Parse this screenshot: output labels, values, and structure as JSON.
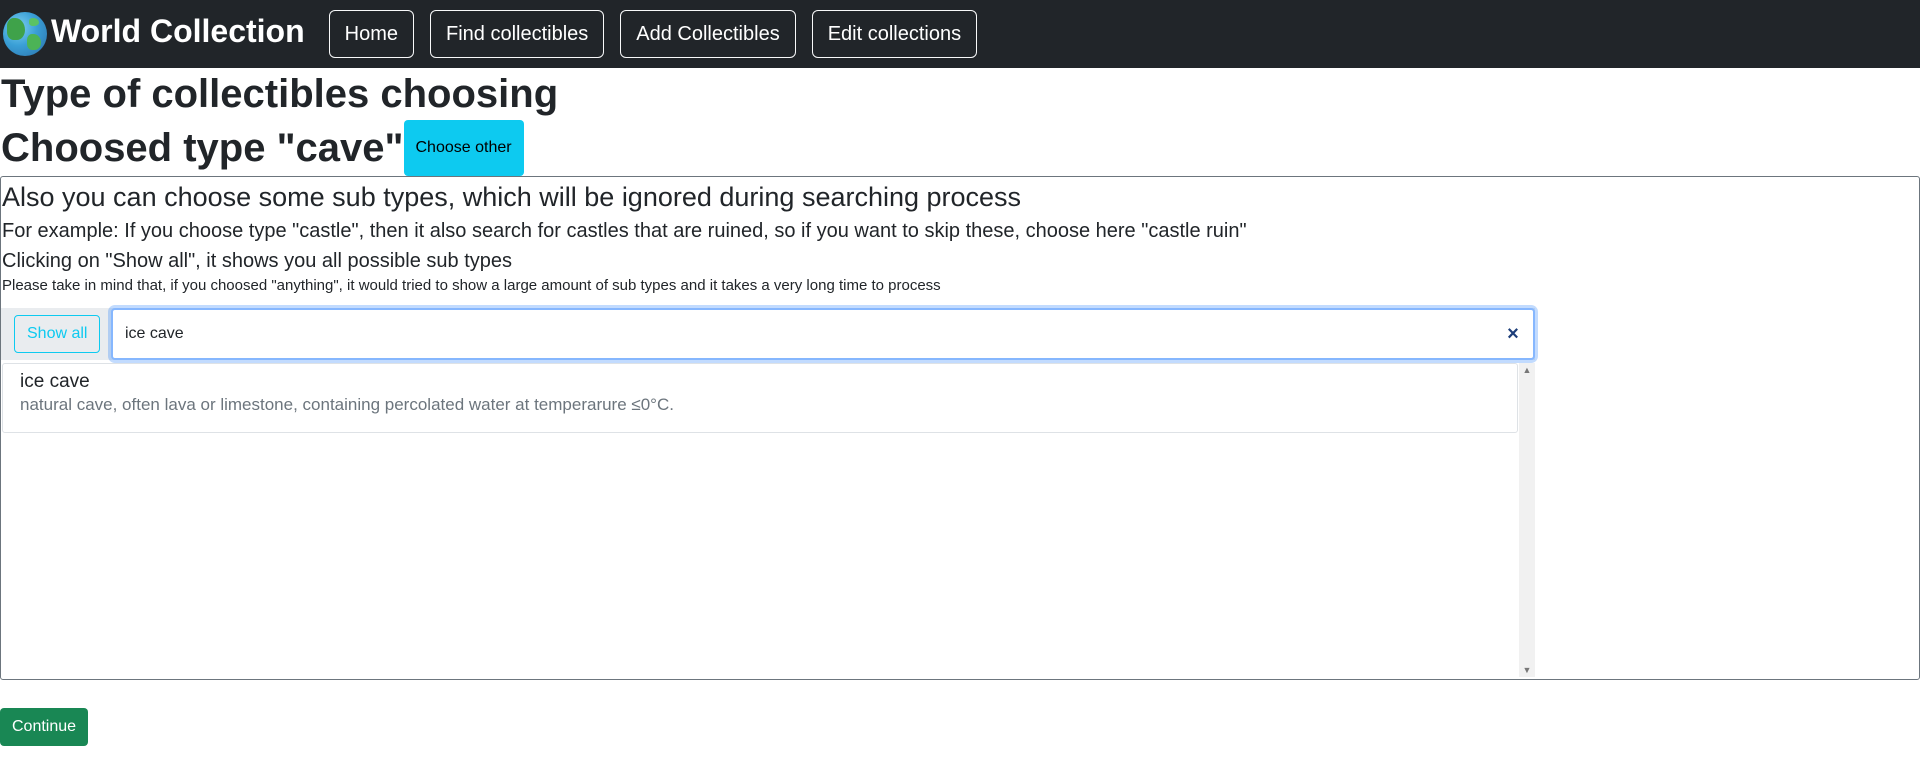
{
  "navbar": {
    "brand_title": "World Collection",
    "items": [
      {
        "label": "Home"
      },
      {
        "label": "Find collectibles"
      },
      {
        "label": "Add Collectibles"
      },
      {
        "label": "Edit collections"
      }
    ]
  },
  "page": {
    "heading": "Type of collectibles choosing",
    "chosen_type_text": "Choosed type \"cave\"",
    "choose_other_label": "Choose other"
  },
  "subtypes": {
    "heading": "Also you can choose some sub types, which will be ignored during searching process",
    "example_text": "For example: If you choose type \"castle\", then it also search for castles that are ruined, so if you want to skip these, choose here \"castle ruin\"",
    "show_all_info": "Clicking on \"Show all\", it shows you all possible sub types",
    "warning_text": "Please take in mind that, if you choosed \"anything\", it would tried to show a large amount of sub types and it takes a very long time to process",
    "show_all_label": "Show all",
    "search_value": "ice cave",
    "clear_symbol": "×",
    "results": [
      {
        "title": "ice cave",
        "description": "natural cave, often lava or limestone, containing percolated water at temperarure ≤0°C."
      }
    ]
  },
  "actions": {
    "continue_label": "Continue"
  },
  "colors": {
    "navbar_bg": "#212529",
    "info": "#0dcaf0",
    "success": "#198754"
  }
}
